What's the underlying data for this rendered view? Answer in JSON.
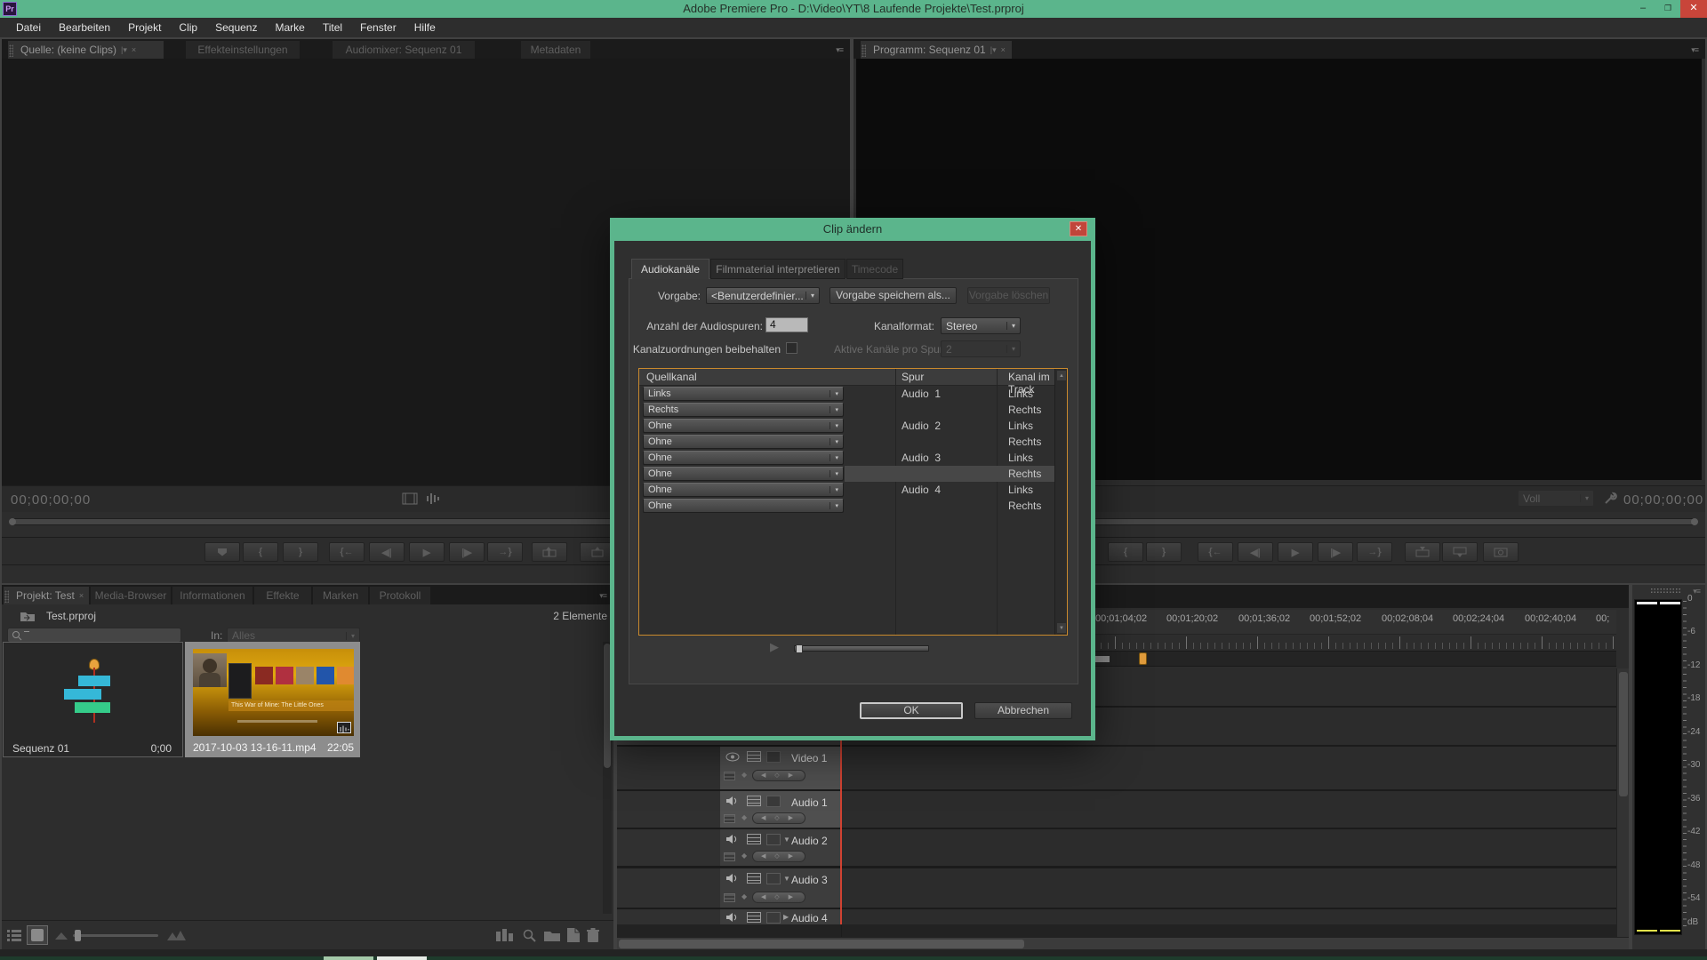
{
  "window": {
    "badge": "Pr",
    "title": "Adobe Premiere Pro - D:\\Video\\YT\\8 Laufende Projekte\\Test.prproj"
  },
  "icons": {
    "minimize": "–",
    "maximize": "❐",
    "close": "✕",
    "tab_close": "×",
    "tab_dropdown": "|▾",
    "dropdown": "▾",
    "panel_menu": "▾≡",
    "up_arrow": "▲",
    "down_arrow": "▼",
    "collapse": "▼",
    "expand": "▶",
    "play": "▶",
    "mark_in": "{",
    "mark_out": "}",
    "goto_in": "{←",
    "step_back": "◀|",
    "step_fwd": "|▶",
    "goto_out": "→}",
    "kf_nav": "◀ ◇ ▶",
    "diamond": "◆"
  },
  "menu": [
    "Datei",
    "Bearbeiten",
    "Projekt",
    "Clip",
    "Sequenz",
    "Marke",
    "Titel",
    "Fenster",
    "Hilfe"
  ],
  "source_panel": {
    "tabs": [
      "Quelle: (keine Clips)",
      "Effekteinstellungen",
      "Audiomixer: Sequenz 01",
      "Metadaten"
    ],
    "timecode": "00;00;00;00"
  },
  "program_panel": {
    "tab": "Programm: Sequenz 01",
    "zoom_level": "Voll",
    "timecode": "00;00;00;00"
  },
  "dialog": {
    "title": "Clip ändern",
    "tabs": [
      {
        "label": "Audiokanäle",
        "state": "active"
      },
      {
        "label": "Filmmaterial interpretieren",
        "state": "enabled"
      },
      {
        "label": "Timecode",
        "state": "disabled"
      }
    ],
    "preset_label": "Vorgabe:",
    "preset_value": "<Benutzerdefinier...",
    "save_preset_label": "Vorgabe speichern als...",
    "delete_preset_label": "Vorgabe löschen",
    "tracks_label": "Anzahl der Audiospuren:",
    "tracks_value": "4",
    "format_label": "Kanalformat:",
    "format_value": "Stereo",
    "keep_label": "Kanalzuordnungen beibehalten",
    "active_label": "Aktive Kanäle pro Spur:",
    "active_value": "2",
    "table": {
      "headers": [
        "Quellkanal",
        "Spur",
        "Kanal im Track"
      ],
      "rows": [
        {
          "source": "Links",
          "track": "Audio  1",
          "channel": "Links",
          "highlight": false
        },
        {
          "source": "Rechts",
          "track": "",
          "channel": "Rechts",
          "highlight": false
        },
        {
          "source": "Ohne",
          "track": "Audio  2",
          "channel": "Links",
          "highlight": false
        },
        {
          "source": "Ohne",
          "track": "",
          "channel": "Rechts",
          "highlight": false
        },
        {
          "source": "Ohne",
          "track": "Audio  3",
          "channel": "Links",
          "highlight": false
        },
        {
          "source": "Ohne",
          "track": "",
          "channel": "Rechts",
          "highlight": true
        },
        {
          "source": "Ohne",
          "track": "Audio  4",
          "channel": "Links",
          "highlight": false
        },
        {
          "source": "Ohne",
          "track": "",
          "channel": "Rechts",
          "highlight": false
        }
      ]
    },
    "ok_label": "OK",
    "cancel_label": "Abbrechen"
  },
  "project_panel": {
    "tabs": [
      "Projekt: Test",
      "Media-Browser",
      "Informationen",
      "Effekte",
      "Marken",
      "Protokoll"
    ],
    "root": "Test.prproj",
    "count": "2 Elemente",
    "filter_label": "In:",
    "filter_value": "Alles",
    "items": [
      {
        "name": "Sequenz 01",
        "duration": "0;00"
      },
      {
        "name": "2017-10-03 13-16-11.mp4",
        "duration": "22:05",
        "caption": "This War of Mine: The Little Ones"
      }
    ]
  },
  "timeline": {
    "ruler": [
      "00;01;04;02",
      "00;01;20;02",
      "00;01;36;02",
      "00;01;52;02",
      "00;02;08;04",
      "00;02;24;04",
      "00;02;40;04",
      "00;"
    ],
    "tracks": [
      {
        "name": "Video 1",
        "type": "video",
        "targeted": true
      },
      {
        "name": "Audio 1",
        "type": "audio",
        "targeted": true
      },
      {
        "name": "Audio 2",
        "type": "audio",
        "targeted": false
      },
      {
        "name": "Audio 3",
        "type": "audio",
        "targeted": false
      },
      {
        "name": "Audio 4",
        "type": "audio",
        "targeted": false
      }
    ]
  },
  "meter": {
    "labels": [
      "0",
      "-6",
      "-12",
      "-18",
      "-24",
      "-30",
      "-36",
      "-42",
      "-48",
      "-54",
      "dB"
    ]
  },
  "colors": {
    "titlebar_green": "#5bb58c",
    "close_red": "#c8453a",
    "table_border_orange": "#c9892d",
    "playhead_red": "#d04232",
    "meter_yellow": "#e2e24a",
    "selection_gray": "#8d8d8d"
  }
}
